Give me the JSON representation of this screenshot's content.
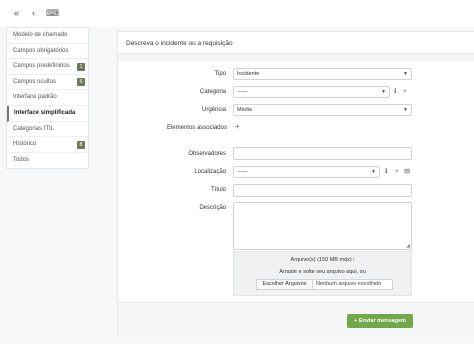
{
  "topbar": {
    "icons": [
      "double-chevron-left-icon",
      "chevron-left-icon",
      "keyboard-icon"
    ],
    "glyphs": [
      "«",
      "‹",
      "⌨"
    ]
  },
  "sidebar": {
    "items": [
      {
        "label": "Modelo de chamado",
        "badge": null
      },
      {
        "label": "Campos obrigatórios",
        "badge": null
      },
      {
        "label": "Campos predefinidos",
        "badge": "1"
      },
      {
        "label": "Campos ocultos",
        "badge": "6"
      },
      {
        "label": "Interface padrão",
        "badge": null
      },
      {
        "label": "Interface simplificada",
        "badge": null,
        "active": true
      },
      {
        "label": "Categorias ITIL",
        "badge": null
      },
      {
        "label": "Histórico",
        "badge": "8"
      },
      {
        "label": "Todos",
        "badge": null
      }
    ]
  },
  "form": {
    "title": "Descreva o incidente ou a requisição",
    "tipo": {
      "label": "Tipo",
      "value": "Incidente"
    },
    "categoria": {
      "label": "Categoria",
      "value": "------"
    },
    "urgencia": {
      "label": "Urgência",
      "value": "Média"
    },
    "elementos": {
      "label": "Elementos associados"
    },
    "observadores": {
      "label": "Observadores"
    },
    "localizacao": {
      "label": "Localização",
      "value": "------"
    },
    "titulo": {
      "label": "Título"
    },
    "descricao": {
      "label": "Descrição"
    },
    "upload": {
      "title": "Arquivo(s) (150 MB máx)",
      "info_icon": "i",
      "drop_text": "Arraste e solte seu arquivo aqui, ou",
      "choose_label": "Escolher Arquivos",
      "none_label": "Nenhum arquivo escolhido"
    },
    "submit_label": "+ Enviar mensagem"
  },
  "colors": {
    "accent_green": "#71a94a",
    "badge": "#6c7a57"
  }
}
